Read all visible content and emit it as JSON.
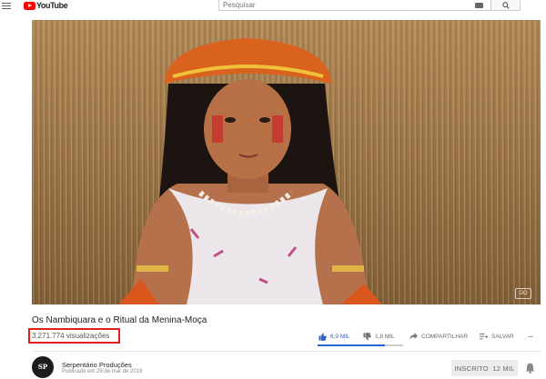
{
  "header": {
    "logo_text": "YouTube",
    "search_placeholder": "Pesquisar",
    "icons": [
      "menu-icon",
      "youtube-logo-icon",
      "keyboard-icon",
      "search-icon"
    ]
  },
  "video": {
    "title": "Os Nambiquara e o Ritual da Menina-Moça",
    "views": "3.271.774 visualizações",
    "watermark": "GO",
    "likes": "6,9 MIL",
    "dislikes": "1,8 MIL",
    "share_label": "COMPARTILHAR",
    "save_label": "SALVAR",
    "more_label": "...",
    "like_ratio": 0.79
  },
  "channel": {
    "name": "Serpentário Produções",
    "published": "Publicado em 29 de mar de 2018",
    "avatar_text": "SP",
    "subscribe_label": "INSCRITO",
    "subscriber_count": "12 MIL"
  },
  "colors": {
    "brand_red": "#ff0000",
    "like_blue": "#2a62cc",
    "highlight_box": "#e0201b"
  }
}
